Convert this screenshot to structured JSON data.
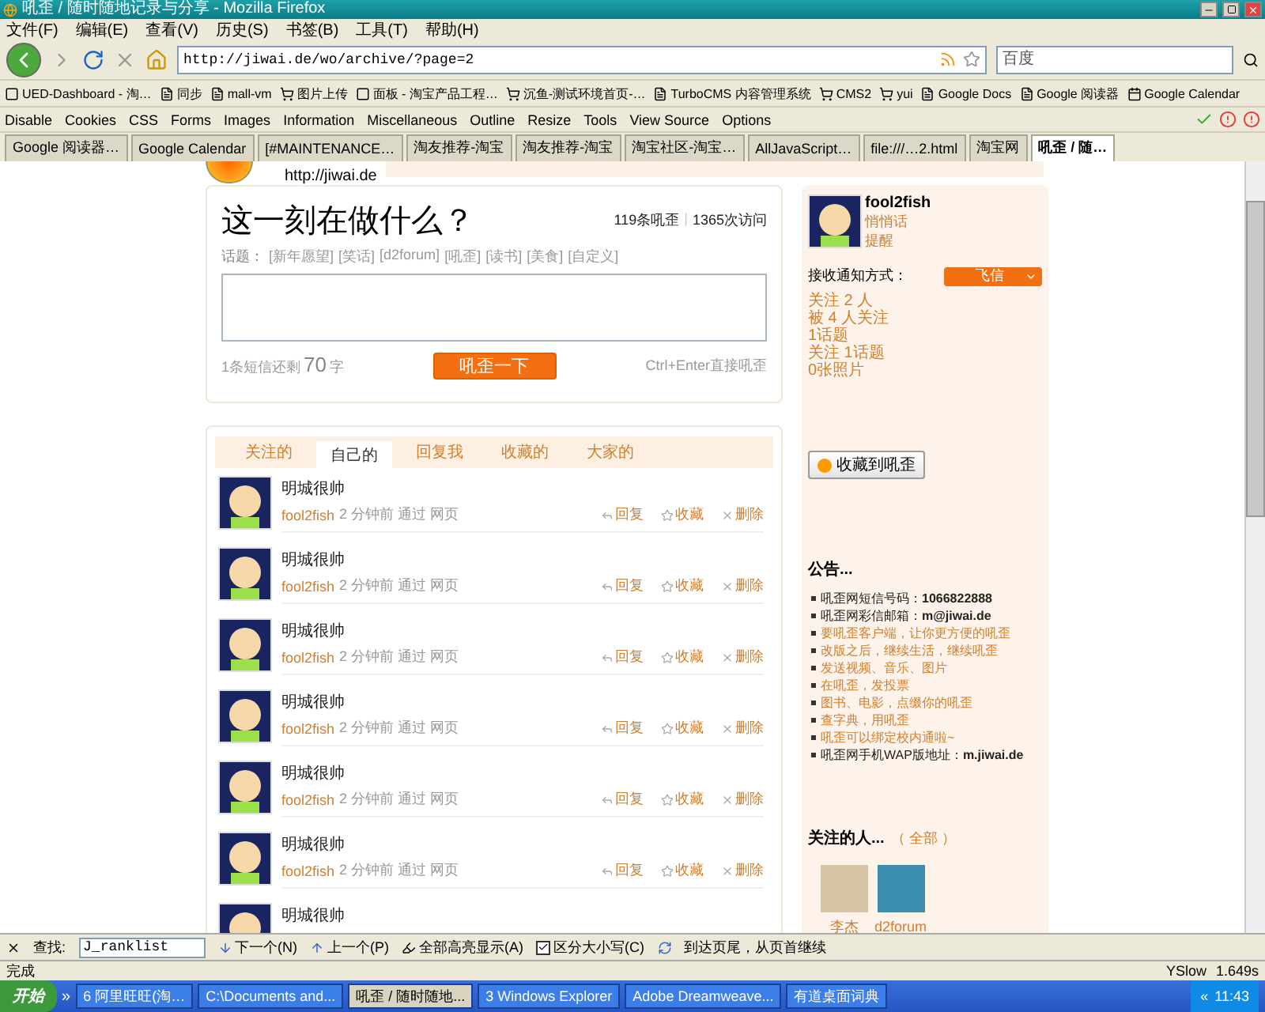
{
  "window": {
    "title": "吼歪 / 随时随地记录与分享 - Mozilla Firefox"
  },
  "menu": [
    "文件(F)",
    "编辑(E)",
    "查看(V)",
    "历史(S)",
    "书签(B)",
    "工具(T)",
    "帮助(H)"
  ],
  "nav": {
    "url": "http://jiwai.de/wo/archive/?page=2",
    "search": {
      "placeholder": "百度"
    }
  },
  "bookmarks": [
    {
      "label": "UED-Dashboard - 淘…",
      "kind": "app"
    },
    {
      "label": "同步",
      "kind": "page"
    },
    {
      "label": "mall-vm",
      "kind": "page"
    },
    {
      "label": "图片上传",
      "kind": "cart"
    },
    {
      "label": "面板 - 淘宝产品工程…",
      "kind": "app"
    },
    {
      "label": "沉鱼-测试环境首页-…",
      "kind": "cart"
    },
    {
      "label": "TurboCMS 内容管理系统",
      "kind": "page"
    },
    {
      "label": "CMS2",
      "kind": "cart"
    },
    {
      "label": "yui",
      "kind": "cart"
    },
    {
      "label": "Google Docs",
      "kind": "page"
    },
    {
      "label": "Google 阅读器",
      "kind": "page"
    },
    {
      "label": "Google Calendar",
      "kind": "calendar"
    }
  ],
  "dev_toolbar": [
    "Disable",
    "Cookies",
    "CSS",
    "Forms",
    "Images",
    "Information",
    "Miscellaneous",
    "Outline",
    "Resize",
    "Tools",
    "View Source",
    "Options"
  ],
  "tabs": [
    {
      "label": "Google 阅读器…",
      "selected": false
    },
    {
      "label": "Google Calendar",
      "selected": false
    },
    {
      "label": "[#MAINTENANCE…",
      "selected": false
    },
    {
      "label": "淘友推荐-淘宝",
      "selected": false
    },
    {
      "label": "淘友推荐-淘宝",
      "selected": false
    },
    {
      "label": "淘宝社区-淘宝…",
      "selected": false
    },
    {
      "label": "AllJavaScript…",
      "selected": false
    },
    {
      "label": "file:///…2.html",
      "selected": false
    },
    {
      "label": "淘宝网",
      "selected": false
    },
    {
      "label": "吼歪 / 随…",
      "selected": true
    }
  ],
  "page": {
    "header_url": "http://jiwai.de",
    "composer": {
      "title": "这一刻在做什么？",
      "stats": [
        "119条吼歪",
        "1365次访问"
      ],
      "stats_separator": "|",
      "topics_label": "话题：",
      "topics": [
        "[新年愿望]",
        "[笑话]",
        "[d2forum]",
        "[吼歪]",
        "[读书]",
        "[美食]",
        "[自定义]"
      ],
      "counter_prefix": "1条短信还剩",
      "counter": "70",
      "counter_suffix": "字",
      "submit": "吼歪一下",
      "hint": "Ctrl+Enter直接吼歪"
    },
    "timeline": {
      "tabs": [
        {
          "label": "关注的",
          "selected": false
        },
        {
          "label": "自己的",
          "selected": true
        },
        {
          "label": "回复我",
          "selected": false
        },
        {
          "label": "收藏的",
          "selected": false
        },
        {
          "label": "大家的",
          "selected": false
        }
      ],
      "posts": [
        {
          "text": "明城很帅",
          "user": "fool2fish",
          "meta": "2 分钟前 通过 网页",
          "actions": [
            "回复",
            "收藏",
            "删除"
          ]
        },
        {
          "text": "明城很帅",
          "user": "fool2fish",
          "meta": "2 分钟前 通过 网页",
          "actions": [
            "回复",
            "收藏",
            "删除"
          ]
        },
        {
          "text": "明城很帅",
          "user": "fool2fish",
          "meta": "2 分钟前 通过 网页",
          "actions": [
            "回复",
            "收藏",
            "删除"
          ]
        },
        {
          "text": "明城很帅",
          "user": "fool2fish",
          "meta": "2 分钟前 通过 网页",
          "actions": [
            "回复",
            "收藏",
            "删除"
          ]
        },
        {
          "text": "明城很帅",
          "user": "fool2fish",
          "meta": "2 分钟前 通过 网页",
          "actions": [
            "回复",
            "收藏",
            "删除"
          ]
        },
        {
          "text": "明城很帅",
          "user": "fool2fish",
          "meta": "2 分钟前 通过 网页",
          "actions": [
            "回复",
            "收藏",
            "删除"
          ]
        },
        {
          "text": "明城很帅"
        }
      ]
    },
    "sidebar": {
      "user": "fool2fish",
      "links": [
        "悄悄话",
        "提醒"
      ],
      "notify_label": "接收通知方式：",
      "notify_value": "飞信",
      "stats": [
        "关注 2 人",
        "被 4 人关注",
        "1话题",
        "关注 1话题",
        "0张照片"
      ],
      "bookmark_button": "收藏到吼歪",
      "notice_title": "公告...",
      "notices": [
        {
          "text": "吼歪网短信号码：**1066822888**",
          "kind": "info"
        },
        {
          "text": "吼歪网彩信邮箱：**m@jiwai.de**",
          "kind": "info"
        },
        {
          "text": "要吼歪客户端，让你更方便的吼歪",
          "kind": "link"
        },
        {
          "text": "改版之后，继续生活，继续吼歪",
          "kind": "link"
        },
        {
          "text": "发送视频、音乐、图片",
          "kind": "link"
        },
        {
          "text": "在吼歪，发投票",
          "kind": "link"
        },
        {
          "text": "图书、电影，点缀你的吼歪",
          "kind": "link"
        },
        {
          "text": "查字典，用吼歪",
          "kind": "link"
        },
        {
          "text": "吼歪可以绑定校内通啦~",
          "kind": "link"
        },
        {
          "text": "吼歪网手机WAP版地址：**m.jiwai.de**",
          "kind": "info"
        }
      ],
      "following_title": "关注的人...",
      "following_all": "（ 全部 ）",
      "following": [
        {
          "name": "李杰",
          "kind": "photo"
        },
        {
          "name": "d2forum",
          "kind": "logo"
        }
      ]
    }
  },
  "find_bar": {
    "label": "查找:",
    "value": "J_ranklist",
    "next": "下一个(N)",
    "prev": "上一个(P)",
    "highlight": "全部高亮显示(A)",
    "match_case": {
      "label": "区分大小写(C)",
      "checked": true
    },
    "message": "到达页尾，从页首继续"
  },
  "status_bar": {
    "text": "完成",
    "plugin": "YSlow",
    "time": "1.649s"
  },
  "taskbar": {
    "start": "开始",
    "more": "»",
    "items": [
      {
        "label": "6 阿里旺旺(淘…",
        "selected": false
      },
      {
        "label": "C:\\Documents and...",
        "selected": false
      },
      {
        "label": "吼歪 / 随时随地...",
        "selected": true
      },
      {
        "label": "3 Windows Explorer",
        "selected": false
      },
      {
        "label": "Adobe Dreamweave...",
        "selected": false
      },
      {
        "label": "有道桌面词典",
        "selected": false
      }
    ],
    "tray_more": "«",
    "clock": "11:43"
  }
}
